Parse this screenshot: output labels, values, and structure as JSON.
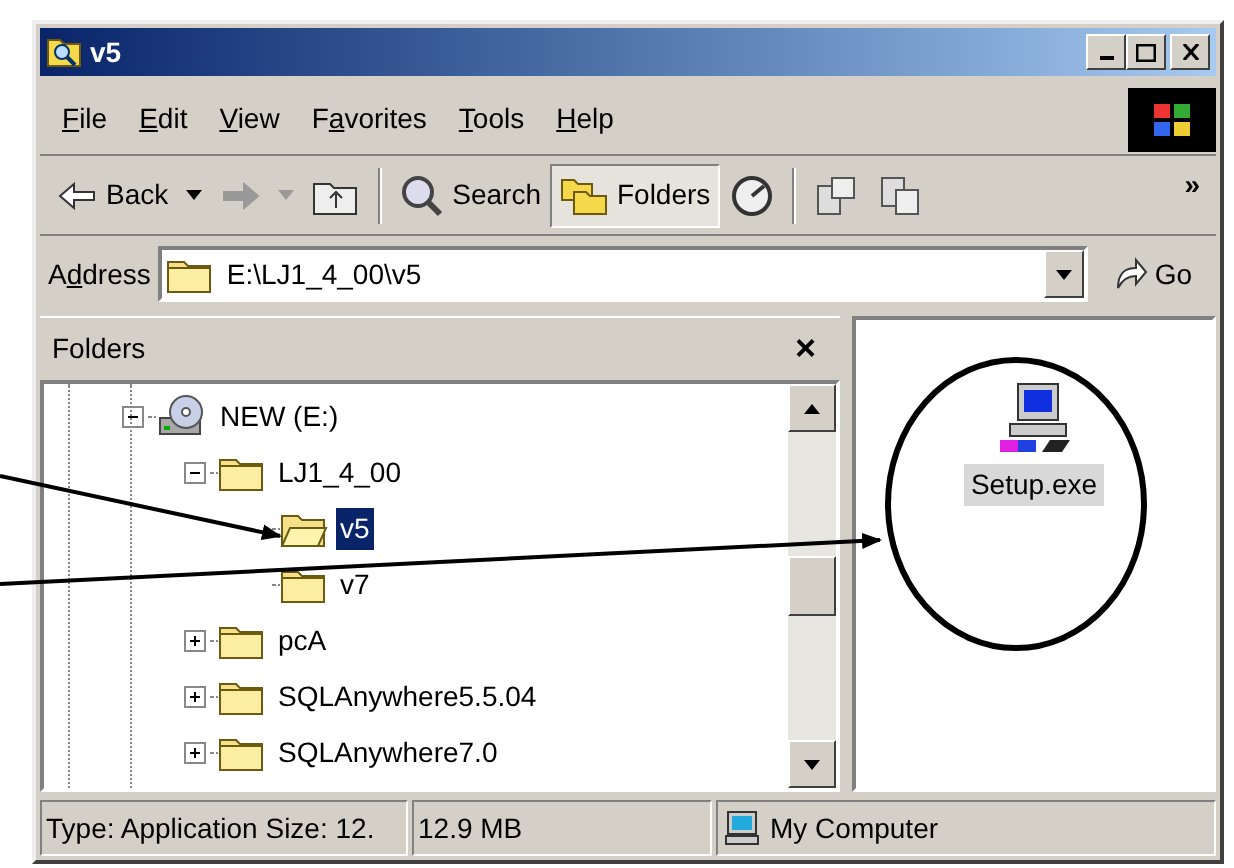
{
  "window": {
    "title": "v5"
  },
  "menu": [
    {
      "key": "F",
      "after": "ile"
    },
    {
      "key": "E",
      "after": "dit"
    },
    {
      "key": "V",
      "after": "iew"
    },
    {
      "before": "F",
      "key": "a",
      "after": "vorites"
    },
    {
      "key": "T",
      "after": "ools"
    },
    {
      "key": "H",
      "after": "elp"
    }
  ],
  "toolbar": [
    {
      "kind": "back",
      "label": "Back",
      "disabled": false,
      "pressed": false
    },
    {
      "kind": "forward",
      "disabled": true,
      "pressed": false
    },
    {
      "kind": "up",
      "disabled": false,
      "pressed": false
    },
    {
      "kind": "search",
      "label": "Search",
      "disabled": false,
      "pressed": false
    },
    {
      "kind": "folders",
      "label": "Folders",
      "disabled": false,
      "pressed": true
    },
    {
      "kind": "history",
      "disabled": false,
      "pressed": false
    },
    {
      "kind": "move",
      "disabled": false,
      "pressed": false
    },
    {
      "kind": "copy",
      "disabled": false,
      "pressed": false
    }
  ],
  "toolbar_overflow": "»",
  "address": {
    "before": "A",
    "key": "d",
    "after": "dress",
    "value": "E:\\LJ1_4_00\\v5",
    "go": "Go"
  },
  "folders_pane": {
    "title": "Folders",
    "close": "×"
  },
  "tree": [
    {
      "label": "NEW (E:)",
      "kind": "drive",
      "expanded": true,
      "selected": false,
      "children": [
        {
          "label": "LJ1_4_00",
          "kind": "folder",
          "expanded": true,
          "selected": false,
          "children": [
            {
              "label": "v5",
              "kind": "folder",
              "selected": true
            },
            {
              "label": "v7",
              "kind": "folder",
              "selected": false
            }
          ]
        },
        {
          "label": "pcA",
          "kind": "folder",
          "expanded": false,
          "selected": false
        },
        {
          "label": "SQLAnywhere5.5.04",
          "kind": "folder",
          "expanded": false,
          "selected": false
        },
        {
          "label": "SQLAnywhere7.0",
          "kind": "folder",
          "expanded": false,
          "selected": false
        }
      ]
    }
  ],
  "files": [
    {
      "name": "Setup.exe",
      "selected": true
    }
  ],
  "status_bar": [
    {
      "text": "Type: Application Size: 12."
    },
    {
      "text": "12.9 MB"
    },
    {
      "text": "My Computer",
      "kind": "zone"
    }
  ]
}
